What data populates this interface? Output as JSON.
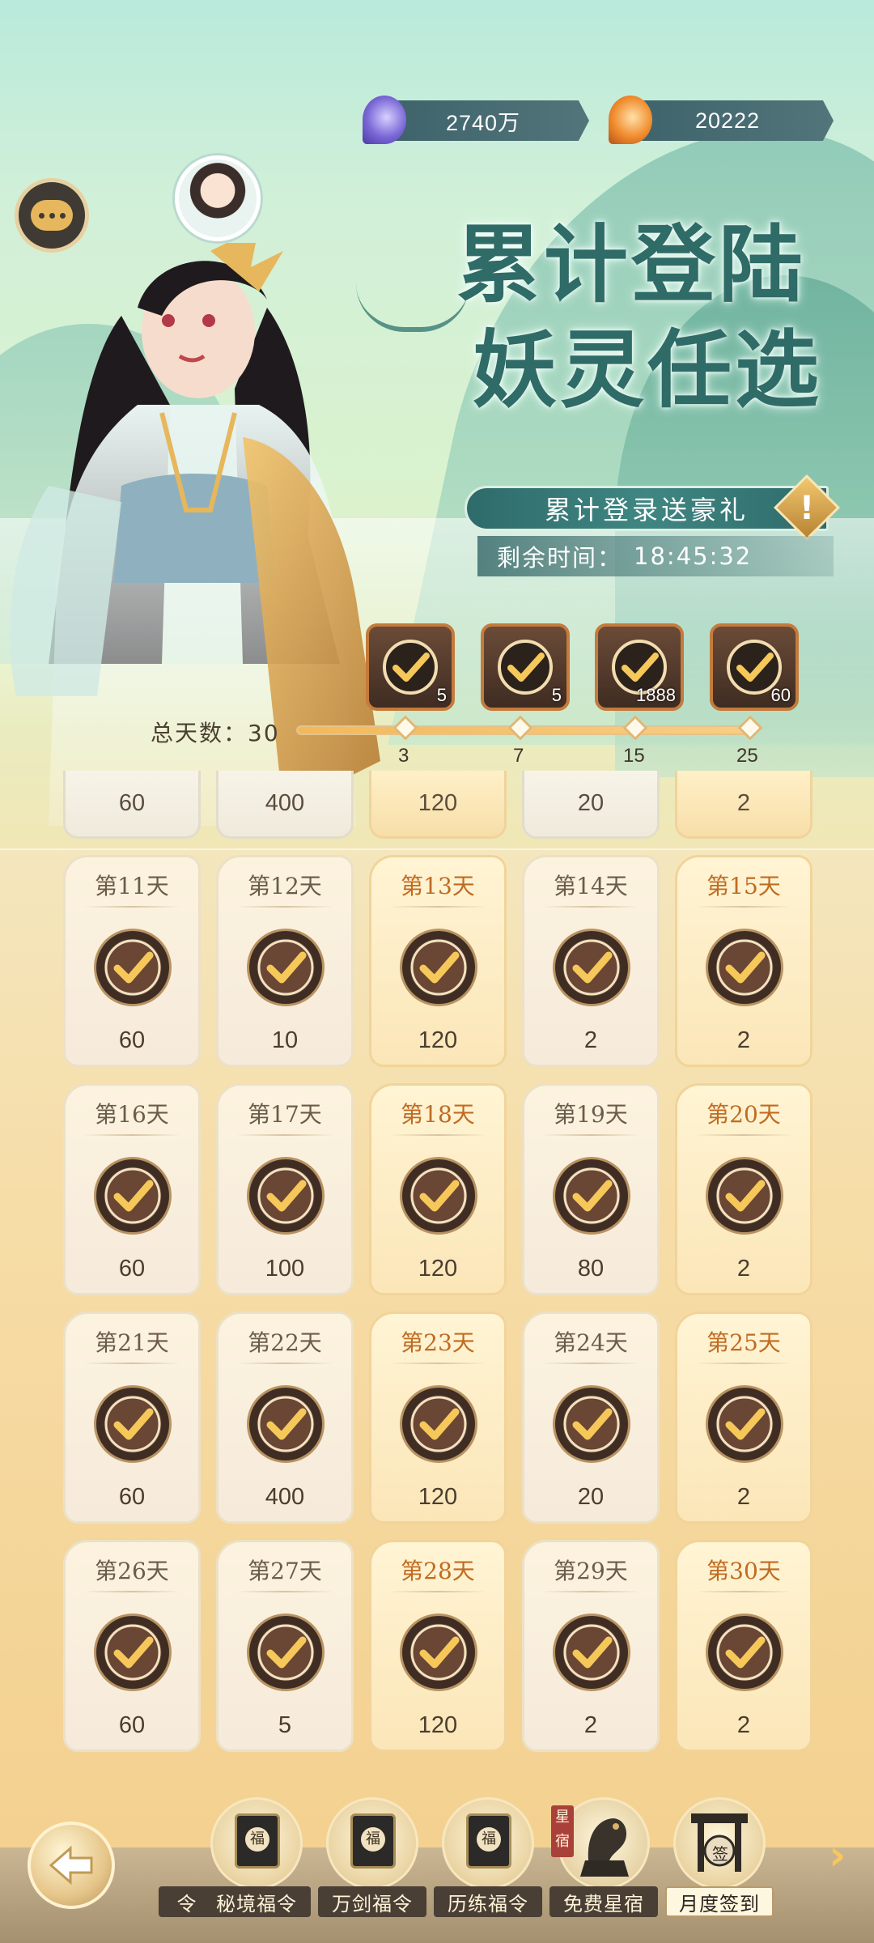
{
  "resources": {
    "gem_amount": "2740万",
    "gem_icon": "purple-flame-icon",
    "gold_amount": "20222",
    "gold_icon": "orange-flame-icon"
  },
  "event": {
    "title_line1": "累计登陆",
    "title_line2": "妖灵任选",
    "banner": "累计登录送豪礼",
    "remaining_label": "剩余时间：",
    "remaining_time": "18:45:32"
  },
  "progress": {
    "label": "总天数：",
    "total_days": "30",
    "milestones": [
      "3",
      "7",
      "15",
      "25"
    ],
    "chests": [
      {
        "qty": "5",
        "claimed": true
      },
      {
        "qty": "5",
        "claimed": true
      },
      {
        "qty": "1888",
        "claimed": true
      },
      {
        "qty": "60",
        "claimed": true
      }
    ]
  },
  "top_row_amounts": [
    "60",
    "400",
    "120",
    "20",
    "2"
  ],
  "days": [
    {
      "label": "第11天",
      "amount": "60",
      "gold": false
    },
    {
      "label": "第12天",
      "amount": "10",
      "gold": false
    },
    {
      "label": "第13天",
      "amount": "120",
      "gold": true
    },
    {
      "label": "第14天",
      "amount": "2",
      "gold": false
    },
    {
      "label": "第15天",
      "amount": "2",
      "gold": true
    },
    {
      "label": "第16天",
      "amount": "60",
      "gold": false
    },
    {
      "label": "第17天",
      "amount": "100",
      "gold": false
    },
    {
      "label": "第18天",
      "amount": "120",
      "gold": true
    },
    {
      "label": "第19天",
      "amount": "80",
      "gold": false
    },
    {
      "label": "第20天",
      "amount": "2",
      "gold": true
    },
    {
      "label": "第21天",
      "amount": "60",
      "gold": false
    },
    {
      "label": "第22天",
      "amount": "400",
      "gold": false
    },
    {
      "label": "第23天",
      "amount": "120",
      "gold": true
    },
    {
      "label": "第24天",
      "amount": "20",
      "gold": false
    },
    {
      "label": "第25天",
      "amount": "2",
      "gold": true
    },
    {
      "label": "第26天",
      "amount": "60",
      "gold": false
    },
    {
      "label": "第27天",
      "amount": "5",
      "gold": false
    },
    {
      "label": "第28天",
      "amount": "120",
      "gold": true
    },
    {
      "label": "第29天",
      "amount": "2",
      "gold": false
    },
    {
      "label": "第30天",
      "amount": "2",
      "gold": true
    }
  ],
  "nav": {
    "tabs": [
      {
        "label": "令",
        "active": false
      },
      {
        "label": "秘境福令",
        "active": false
      },
      {
        "label": "万剑福令",
        "active": false
      },
      {
        "label": "历练福令",
        "active": false
      },
      {
        "label": "免费星宿",
        "active": false
      },
      {
        "label": "月度签到",
        "active": true
      }
    ],
    "book_glyph": "福",
    "star_tag": "星宿",
    "sign_glyph": "签"
  },
  "colors": {
    "title": "#2f6b67",
    "gold_day": "#c06b22",
    "check": "#f6c85a"
  }
}
